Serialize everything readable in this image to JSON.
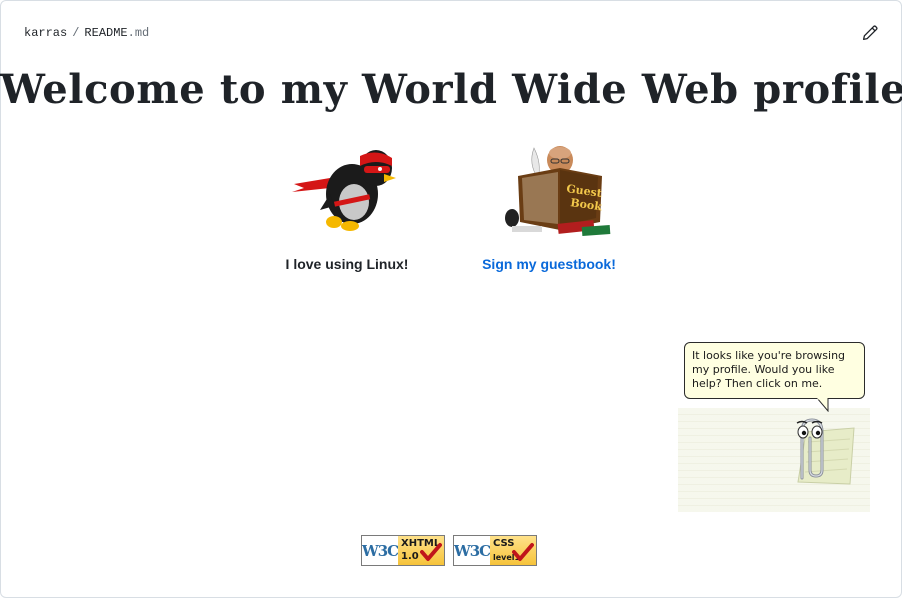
{
  "breadcrumb": {
    "repo": "karras",
    "separator": "/",
    "file_name": "README",
    "file_ext": ".md"
  },
  "toolbar": {
    "edit_icon": "pencil-icon"
  },
  "readme": {
    "title": "Welcome to my World Wide Web profile!",
    "cards": {
      "linux": {
        "label": "I love using Linux!",
        "image": "tux-ninja-icon"
      },
      "guestbook": {
        "label": "Sign my guestbook!",
        "image": "guestbook-reader-icon"
      }
    },
    "clippy": {
      "bubble_line1": "It looks like you're browsing",
      "bubble_line2": "my profile. Would you like",
      "bubble_line3": "help? Then click on me.",
      "image": "paperclip-assistant-icon"
    },
    "badges": {
      "xhtml": {
        "logo": "W3C",
        "line1": "XHTML",
        "line2": "1.0"
      },
      "css": {
        "logo": "W3C",
        "line1": "CSS",
        "line2": "level1"
      }
    }
  },
  "colors": {
    "link": "#0969da",
    "text": "#1f2328",
    "muted": "#656d76",
    "bubble_bg": "#ffffe1"
  }
}
